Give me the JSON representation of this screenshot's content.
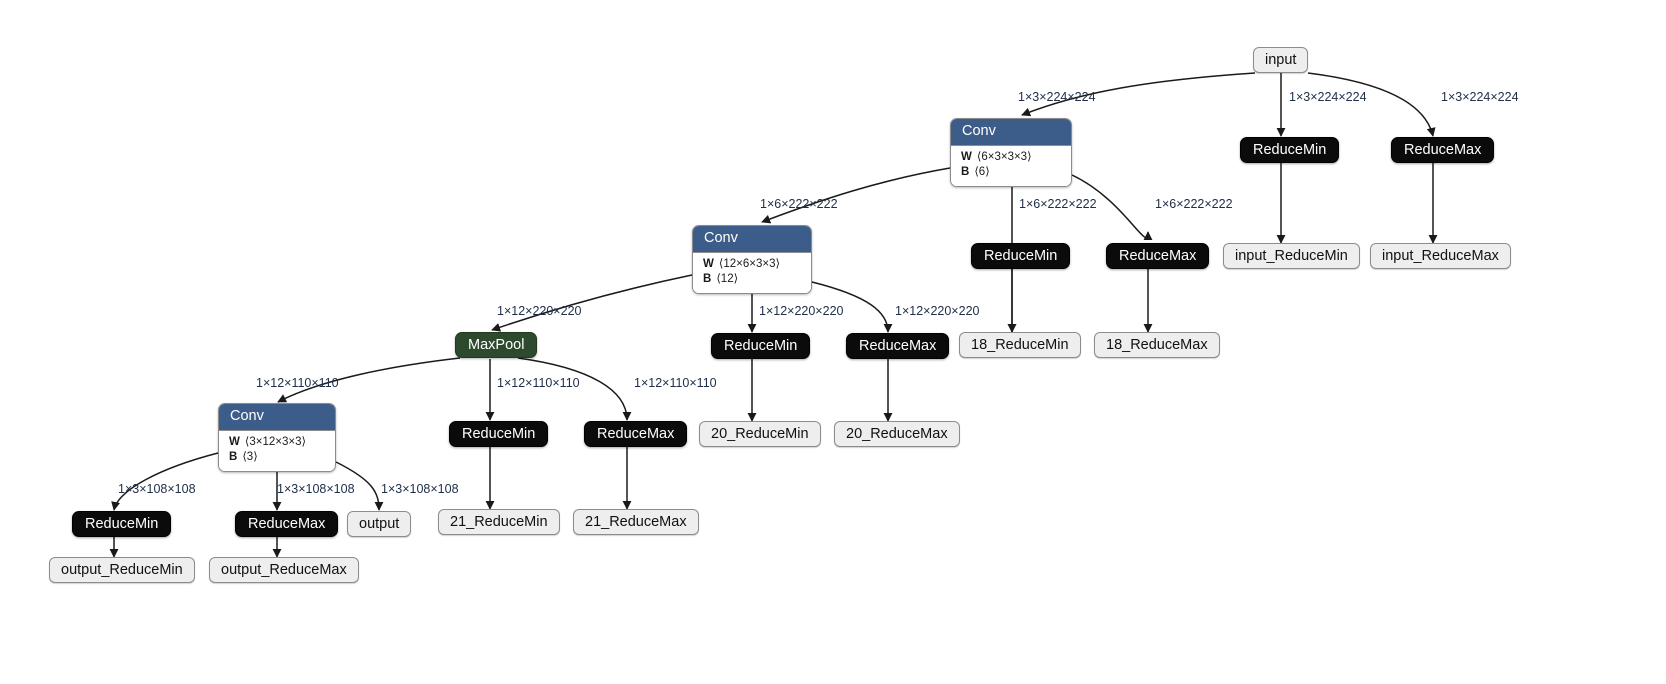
{
  "graph": {
    "title": "ONNX model graph",
    "colors": {
      "conv_header": "#3c5c8a",
      "pool": "#2e4a2e",
      "op": "#0b0b0b",
      "io": "#eeeeee",
      "edge": "#1a1a1a",
      "edge_label_text": "#20304a"
    }
  },
  "nodes": {
    "input": {
      "label": "input",
      "type": "io"
    },
    "conv1": {
      "title": "Conv",
      "params": [
        {
          "name": "W",
          "shape": "⟨6×3×3×3⟩"
        },
        {
          "name": "B",
          "shape": "⟨6⟩"
        }
      ]
    },
    "conv2": {
      "title": "Conv",
      "params": [
        {
          "name": "W",
          "shape": "⟨12×6×3×3⟩"
        },
        {
          "name": "B",
          "shape": "⟨12⟩"
        }
      ]
    },
    "conv3": {
      "title": "Conv",
      "params": [
        {
          "name": "W",
          "shape": "⟨3×12×3×3⟩"
        },
        {
          "name": "B",
          "shape": "⟨3⟩"
        }
      ]
    },
    "maxpool": {
      "label": "MaxPool",
      "type": "pool"
    },
    "input_reducemin_op": {
      "label": "ReduceMin",
      "type": "op"
    },
    "input_reducemax_op": {
      "label": "ReduceMax",
      "type": "op"
    },
    "c1_reducemin_op": {
      "label": "ReduceMin",
      "type": "op"
    },
    "c1_reducemax_op": {
      "label": "ReduceMax",
      "type": "op"
    },
    "c2_reducemin_op": {
      "label": "ReduceMin",
      "type": "op"
    },
    "c2_reducemax_op": {
      "label": "ReduceMax",
      "type": "op"
    },
    "mp_reducemin_op": {
      "label": "ReduceMin",
      "type": "op"
    },
    "mp_reducemax_op": {
      "label": "ReduceMax",
      "type": "op"
    },
    "c3_reducemin_op": {
      "label": "ReduceMin",
      "type": "op"
    },
    "c3_reducemax_op": {
      "label": "ReduceMax",
      "type": "op"
    },
    "input_reducemin_out": {
      "label": "input_ReduceMin",
      "type": "io"
    },
    "input_reducemax_out": {
      "label": "input_ReduceMax",
      "type": "io"
    },
    "n18_reducemin_out": {
      "label": "18_ReduceMin",
      "type": "io"
    },
    "n18_reducemax_out": {
      "label": "18_ReduceMax",
      "type": "io"
    },
    "n20_reducemin_out": {
      "label": "20_ReduceMin",
      "type": "io"
    },
    "n20_reducemax_out": {
      "label": "20_ReduceMax",
      "type": "io"
    },
    "n21_reducemin_out": {
      "label": "21_ReduceMin",
      "type": "io"
    },
    "n21_reducemax_out": {
      "label": "21_ReduceMax",
      "type": "io"
    },
    "output": {
      "label": "output",
      "type": "io"
    },
    "output_reducemin_out": {
      "label": "output_ReduceMin",
      "type": "io"
    },
    "output_reducemax_out": {
      "label": "output_ReduceMax",
      "type": "io"
    }
  },
  "edge_labels": {
    "input_to_conv1": "1×3×224×224",
    "input_to_rmin": "1×3×224×224",
    "input_to_rmax": "1×3×224×224",
    "conv1_to_conv2": "1×6×222×222",
    "conv1_to_rmin": "1×6×222×222",
    "conv1_to_rmax": "1×6×222×222",
    "conv2_to_maxpool": "1×12×220×220",
    "conv2_to_rmin": "1×12×220×220",
    "conv2_to_rmax": "1×12×220×220",
    "maxpool_to_conv3": "1×12×110×110",
    "maxpool_to_rmin": "1×12×110×110",
    "maxpool_to_rmax": "1×12×110×110",
    "conv3_to_rmin": "1×3×108×108",
    "conv3_to_rmax": "1×3×108×108",
    "conv3_to_output": "1×3×108×108"
  }
}
